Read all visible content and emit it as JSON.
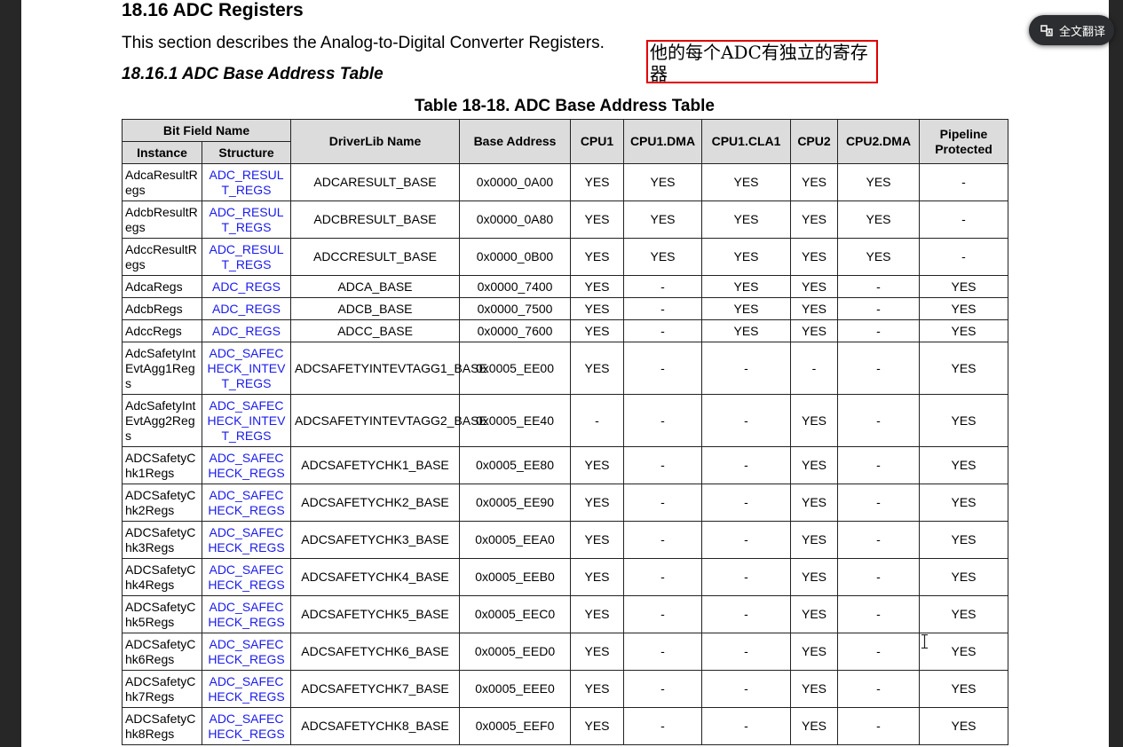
{
  "section_heading": "18.16 ADC Registers",
  "intro_text": "This section describes the Analog-to-Digital Converter Registers.",
  "subsection_heading": "18.16.1 ADC Base Address Table",
  "annotation_note": "他的每个ADC有独立的寄存器",
  "translate_button": {
    "label": "全文翻译",
    "icon": "translate-icon"
  },
  "table": {
    "caption": "Table 18-18. ADC Base Address Table",
    "headers": {
      "bit_field_name": "Bit Field Name",
      "instance": "Instance",
      "structure": "Structure",
      "driverlib_name": "DriverLib Name",
      "base_address": "Base Address",
      "cpu1": "CPU1",
      "cpu1_dma": "CPU1.DMA",
      "cpu1_cla1": "CPU1.CLA1",
      "cpu2": "CPU2",
      "cpu2_dma": "CPU2.DMA",
      "pipeline_protected": "Pipeline Protected"
    },
    "rows": [
      {
        "instance": "AdcaResultRegs",
        "structure": "ADC_RESULT_REGS",
        "driverlib": "ADCARESULT_BASE",
        "base": "0x0000_0A00",
        "cpu1": "YES",
        "cpu1_dma": "YES",
        "cpu1_cla1": "YES",
        "cpu2": "YES",
        "cpu2_dma": "YES",
        "pipeline": "-"
      },
      {
        "instance": "AdcbResultRegs",
        "structure": "ADC_RESULT_REGS",
        "driverlib": "ADCBRESULT_BASE",
        "base": "0x0000_0A80",
        "cpu1": "YES",
        "cpu1_dma": "YES",
        "cpu1_cla1": "YES",
        "cpu2": "YES",
        "cpu2_dma": "YES",
        "pipeline": "-"
      },
      {
        "instance": "AdccResultRegs",
        "structure": "ADC_RESULT_REGS",
        "driverlib": "ADCCRESULT_BASE",
        "base": "0x0000_0B00",
        "cpu1": "YES",
        "cpu1_dma": "YES",
        "cpu1_cla1": "YES",
        "cpu2": "YES",
        "cpu2_dma": "YES",
        "pipeline": "-"
      },
      {
        "instance": "AdcaRegs",
        "structure": "ADC_REGS",
        "driverlib": "ADCA_BASE",
        "base": "0x0000_7400",
        "cpu1": "YES",
        "cpu1_dma": "-",
        "cpu1_cla1": "YES",
        "cpu2": "YES",
        "cpu2_dma": "-",
        "pipeline": "YES"
      },
      {
        "instance": "AdcbRegs",
        "structure": "ADC_REGS",
        "driverlib": "ADCB_BASE",
        "base": "0x0000_7500",
        "cpu1": "YES",
        "cpu1_dma": "-",
        "cpu1_cla1": "YES",
        "cpu2": "YES",
        "cpu2_dma": "-",
        "pipeline": "YES"
      },
      {
        "instance": "AdccRegs",
        "structure": "ADC_REGS",
        "driverlib": "ADCC_BASE",
        "base": "0x0000_7600",
        "cpu1": "YES",
        "cpu1_dma": "-",
        "cpu1_cla1": "YES",
        "cpu2": "YES",
        "cpu2_dma": "-",
        "pipeline": "YES"
      },
      {
        "instance": "AdcSafetyIntEvtAgg1Regs",
        "structure": "ADC_SAFECHECK_INTEVT_REGS",
        "driverlib": "ADCSAFETYINTEVTAGG1_BASE",
        "base": "0x0005_EE00",
        "cpu1": "YES",
        "cpu1_dma": "-",
        "cpu1_cla1": "-",
        "cpu2": "-",
        "cpu2_dma": "-",
        "pipeline": "YES"
      },
      {
        "instance": "AdcSafetyIntEvtAgg2Regs",
        "structure": "ADC_SAFECHECK_INTEVT_REGS",
        "driverlib": "ADCSAFETYINTEVTAGG2_BASE",
        "base": "0x0005_EE40",
        "cpu1": "-",
        "cpu1_dma": "-",
        "cpu1_cla1": "-",
        "cpu2": "YES",
        "cpu2_dma": "-",
        "pipeline": "YES"
      },
      {
        "instance": "ADCSafetyChk1Regs",
        "structure": "ADC_SAFECHECK_REGS",
        "driverlib": "ADCSAFETYCHK1_BASE",
        "base": "0x0005_EE80",
        "cpu1": "YES",
        "cpu1_dma": "-",
        "cpu1_cla1": "-",
        "cpu2": "YES",
        "cpu2_dma": "-",
        "pipeline": "YES"
      },
      {
        "instance": "ADCSafetyChk2Regs",
        "structure": "ADC_SAFECHECK_REGS",
        "driverlib": "ADCSAFETYCHK2_BASE",
        "base": "0x0005_EE90",
        "cpu1": "YES",
        "cpu1_dma": "-",
        "cpu1_cla1": "-",
        "cpu2": "YES",
        "cpu2_dma": "-",
        "pipeline": "YES"
      },
      {
        "instance": "ADCSafetyChk3Regs",
        "structure": "ADC_SAFECHECK_REGS",
        "driverlib": "ADCSAFETYCHK3_BASE",
        "base": "0x0005_EEA0",
        "cpu1": "YES",
        "cpu1_dma": "-",
        "cpu1_cla1": "-",
        "cpu2": "YES",
        "cpu2_dma": "-",
        "pipeline": "YES"
      },
      {
        "instance": "ADCSafetyChk4Regs",
        "structure": "ADC_SAFECHECK_REGS",
        "driverlib": "ADCSAFETYCHK4_BASE",
        "base": "0x0005_EEB0",
        "cpu1": "YES",
        "cpu1_dma": "-",
        "cpu1_cla1": "-",
        "cpu2": "YES",
        "cpu2_dma": "-",
        "pipeline": "YES"
      },
      {
        "instance": "ADCSafetyChk5Regs",
        "structure": "ADC_SAFECHECK_REGS",
        "driverlib": "ADCSAFETYCHK5_BASE",
        "base": "0x0005_EEC0",
        "cpu1": "YES",
        "cpu1_dma": "-",
        "cpu1_cla1": "-",
        "cpu2": "YES",
        "cpu2_dma": "-",
        "pipeline": "YES"
      },
      {
        "instance": "ADCSafetyChk6Regs",
        "structure": "ADC_SAFECHECK_REGS",
        "driverlib": "ADCSAFETYCHK6_BASE",
        "base": "0x0005_EED0",
        "cpu1": "YES",
        "cpu1_dma": "-",
        "cpu1_cla1": "-",
        "cpu2": "YES",
        "cpu2_dma": "-",
        "pipeline": "YES"
      },
      {
        "instance": "ADCSafetyChk7Regs",
        "structure": "ADC_SAFECHECK_REGS",
        "driverlib": "ADCSAFETYCHK7_BASE",
        "base": "0x0005_EEE0",
        "cpu1": "YES",
        "cpu1_dma": "-",
        "cpu1_cla1": "-",
        "cpu2": "YES",
        "cpu2_dma": "-",
        "pipeline": "YES"
      },
      {
        "instance": "ADCSafetyChk8Regs",
        "structure": "ADC_SAFECHECK_REGS",
        "driverlib": "ADCSAFETYCHK8_BASE",
        "base": "0x0005_EEF0",
        "cpu1": "YES",
        "cpu1_dma": "-",
        "cpu1_cla1": "-",
        "cpu2": "YES",
        "cpu2_dma": "-",
        "pipeline": "YES"
      }
    ]
  }
}
